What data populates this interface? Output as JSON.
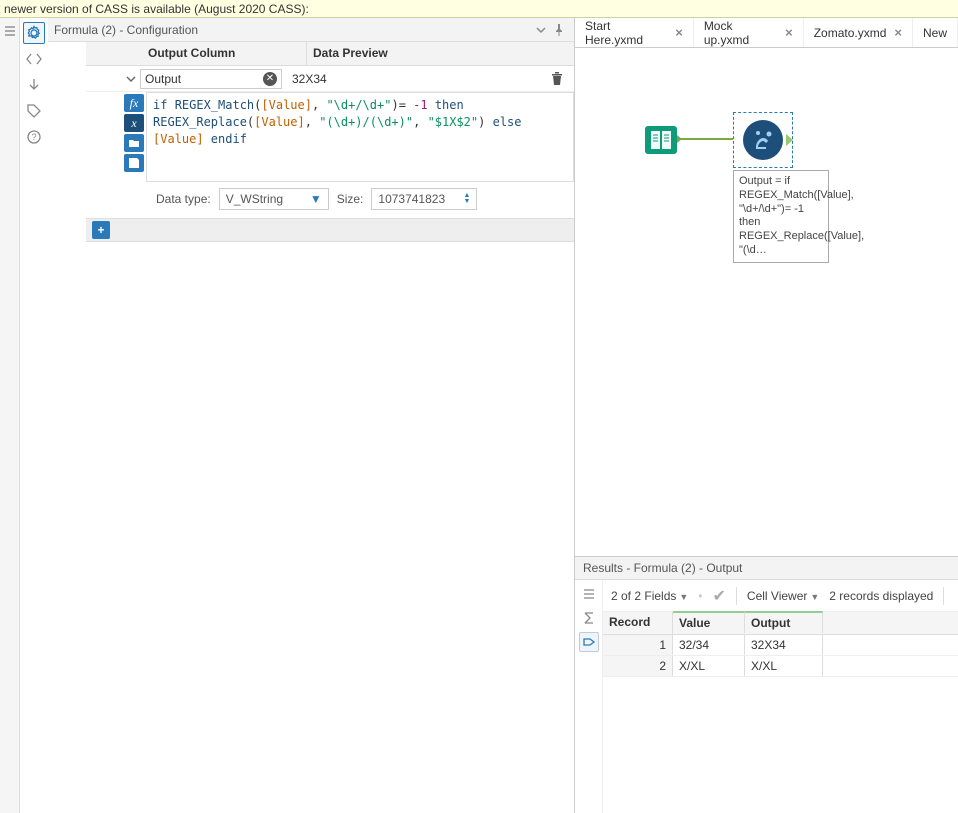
{
  "notice": "newer version of CASS is available (August 2020 CASS):",
  "config_panel_title": "Formula (2) - Configuration",
  "headers": {
    "output": "Output Column",
    "preview": "Data Preview"
  },
  "output_row": {
    "name": "Output",
    "preview": "32X34"
  },
  "formula_tokens": [
    {
      "t": "kw",
      "v": "if "
    },
    {
      "t": "fn",
      "v": "REGEX_Match"
    },
    {
      "t": "",
      "v": "("
    },
    {
      "t": "field",
      "v": "[Value]"
    },
    {
      "t": "",
      "v": ", "
    },
    {
      "t": "str",
      "v": "\"\\d+/\\d+\""
    },
    {
      "t": "",
      "v": ")= "
    },
    {
      "t": "num",
      "v": "-1"
    },
    {
      "t": "kw",
      "v": " then "
    },
    {
      "t": "fn",
      "v": "REGEX_Replace"
    },
    {
      "t": "",
      "v": "("
    },
    {
      "t": "field",
      "v": "[Value]"
    },
    {
      "t": "",
      "v": ", "
    },
    {
      "t": "str",
      "v": "\"(\\d+)/(\\d+)\""
    },
    {
      "t": "",
      "v": ", "
    },
    {
      "t": "str",
      "v": "\"$1X$2\""
    },
    {
      "t": "",
      "v": ") "
    },
    {
      "t": "kw",
      "v": "else "
    },
    {
      "t": "field",
      "v": "[Value]"
    },
    {
      "t": "kw",
      "v": " endif"
    }
  ],
  "datatype": {
    "label": "Data type:",
    "value": "V_WString",
    "size_label": "Size:",
    "size_value": "1073741823"
  },
  "tabs": [
    {
      "label": "Start Here.yxmd",
      "closable": true
    },
    {
      "label": "Mock up.yxmd",
      "closable": true
    },
    {
      "label": "Zomato.yxmd",
      "closable": true
    },
    {
      "label": "New",
      "closable": false
    }
  ],
  "annotation": "Output = if REGEX_Match([Value], \"\\d+/\\d+\")= -1 then REGEX_Replace([Value], \"(\\d…",
  "results": {
    "title": "Results - Formula (2) - Output",
    "fields_summary": "2 of 2 Fields",
    "cell_viewer": "Cell Viewer",
    "records_summary": "2 records displayed",
    "columns": [
      "Record",
      "Value",
      "Output"
    ],
    "rows": [
      {
        "idx": "1",
        "value": "32/34",
        "output": "32X34"
      },
      {
        "idx": "2",
        "value": "X/XL",
        "output": "X/XL"
      }
    ]
  }
}
